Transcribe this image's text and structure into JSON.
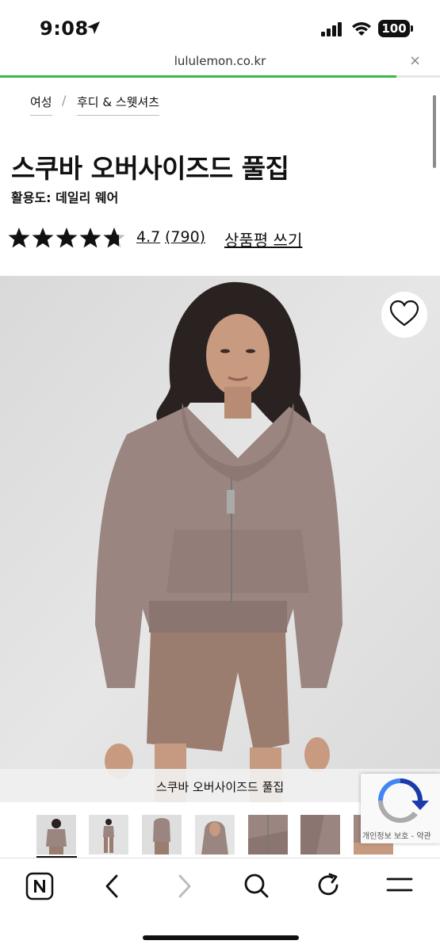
{
  "status_bar": {
    "time": "9:08",
    "battery": "100"
  },
  "browser": {
    "url": "lululemon.co.kr",
    "close_label": "×",
    "load_progress": 0.9
  },
  "breadcrumb": {
    "items": [
      "여성",
      "후디 & 스웻셔츠"
    ],
    "separator": "/"
  },
  "product": {
    "title": "스쿠바 오버사이즈드 풀집",
    "activity": "활용도: 데일리 웨어",
    "rating_value": "4.7",
    "rating_count": "(790)",
    "rating_stars": 4.7,
    "write_review": "상품평 쓰기",
    "image_caption": "스쿠바 오버사이즈드 풀집",
    "thumbnail_count": 7,
    "selected_thumbnail": 1
  },
  "recaptcha": {
    "text": "개인정보 보호 - 약관"
  },
  "colors": {
    "progress": "#3cb54a",
    "hoodie": "#9a8580",
    "background": "#e3e3e3"
  },
  "toolbar": {
    "icons": [
      "naver-home-icon",
      "back-icon",
      "forward-icon",
      "search-icon",
      "reload-icon",
      "menu-icon"
    ]
  }
}
